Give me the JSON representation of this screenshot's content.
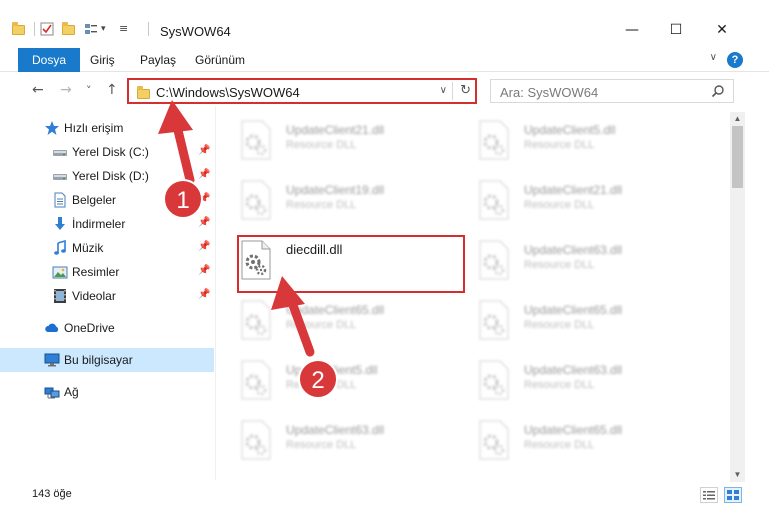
{
  "window": {
    "title": "SysWOW64",
    "minimize_glyph": "—",
    "maximize_glyph": "☐",
    "close_glyph": "✕"
  },
  "ribbon": {
    "tabs": [
      "Dosya",
      "Giriş",
      "Paylaş",
      "Görünüm"
    ],
    "help_glyph": "?"
  },
  "nav": {
    "back_glyph": "←",
    "forward_glyph": "→",
    "recent_glyph": "˅",
    "up_glyph": "↑",
    "address": "C:\\Windows\\SysWOW64",
    "search_placeholder": "Ara: SysWOW64"
  },
  "sidebar": {
    "items": [
      {
        "label": "Hızlı erişim",
        "icon": "star-icon"
      },
      {
        "label": "Yerel Disk (C:)",
        "icon": "drive-icon"
      },
      {
        "label": "Yerel Disk (D:)",
        "icon": "drive-icon"
      },
      {
        "label": "Belgeler",
        "icon": "documents-icon"
      },
      {
        "label": "İndirmeler",
        "icon": "download-icon"
      },
      {
        "label": "Müzik",
        "icon": "music-icon"
      },
      {
        "label": "Resimler",
        "icon": "pictures-icon"
      },
      {
        "label": "Videolar",
        "icon": "videos-icon"
      },
      {
        "label": "OneDrive",
        "icon": "cloud-icon"
      },
      {
        "label": "Bu bilgisayar",
        "icon": "computer-icon"
      },
      {
        "label": "Ağ",
        "icon": "network-icon"
      }
    ],
    "pin_glyph": "📌",
    "selected": "Bu bilgisayar"
  },
  "files": {
    "highlighted": {
      "name": "diecdill.dll"
    },
    "blurred": [
      {
        "name": "UpdateClient21.dll",
        "type": "Resource DLL"
      },
      {
        "name": "UpdateClient5.dll",
        "type": "Resource DLL"
      },
      {
        "name": "UpdateClient19.dll",
        "type": "Resource DLL"
      },
      {
        "name": "UpdateClient21.dll",
        "type": "Resource DLL"
      },
      {
        "name": "UpdateClient63.dll",
        "type": "Resource DLL"
      },
      {
        "name": "UpdateClient65.dll",
        "type": "Resource DLL"
      },
      {
        "name": "UpdateClient65.dll",
        "type": "Resource DLL"
      },
      {
        "name": "UpdateClient5.dll",
        "type": "Resource DLL"
      },
      {
        "name": "UpdateClient63.dll",
        "type": "Resource DLL"
      },
      {
        "name": "UpdateClient63.dll",
        "type": "Resource DLL"
      },
      {
        "name": "UpdateClient65.dll",
        "type": "Resource DLL"
      }
    ]
  },
  "status": {
    "item_count": "143 öğe"
  },
  "annotations": {
    "step1": "1",
    "step2": "2"
  },
  "colors": {
    "accent": "#1979ca",
    "highlight_border": "#d42e2e",
    "selection_bg": "#cce8ff",
    "badge": "#d9383a"
  }
}
